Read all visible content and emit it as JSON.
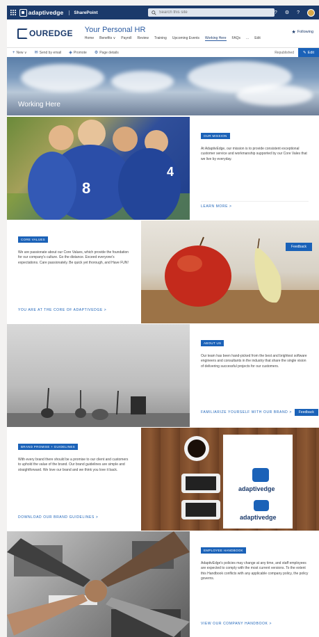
{
  "suite": {
    "brand": "adaptivedge",
    "app": "SharePoint",
    "search_placeholder": "Search this site",
    "icons": [
      "app-launcher-icon",
      "help-icon",
      "settings-icon",
      "question-icon"
    ]
  },
  "site": {
    "logo_text": "OUREDGE",
    "title": "Your Personal HR",
    "nav": [
      "Home",
      "Benefits ∨",
      "Payroll",
      "Review",
      "Training",
      "Upcoming Events",
      "Working Here",
      "FAQs",
      "...",
      "Edit"
    ],
    "active_nav": "Working Here",
    "follow_label": "Following"
  },
  "commandbar": {
    "new": "New ∨",
    "send": "Send by email",
    "promote": "Promote",
    "page_details": "Page details",
    "published": "Republished",
    "edit": "Edit"
  },
  "hero": {
    "title": "Working Here"
  },
  "sections": [
    {
      "label": "OUR MISSION",
      "body": "At AdaptivEdge, our mission is to provide consistent exceptional customer service and workmanship supported by our Core Vales that we live by everyday.",
      "link": "LEARN MORE >"
    },
    {
      "label": "CORE VALUES",
      "body": "We are passionate about our Core Values, which provide the foundation for our company's culture. Go the distance. Exceed everyone's expectations. Care passionately. Be quick yet thorough, and Have FUN!",
      "link": "YOU ARE AT THE CORE OF ADAPTIVEDGE >",
      "feedback": "Feedback"
    },
    {
      "label": "ABOUT US",
      "body": "Our team has been hand-picked from the best and brightest software engineers and consultants in the industry that share the single vision of delivering successful projects for our customers.",
      "link": "FAMILIARIZE YOURSELF WITH OUR BRAND >",
      "feedback": "Feedback"
    },
    {
      "label": "BRAND PROMISE + GUIDELINES",
      "body": "With every brand there should be a promise to our client and customers to uphold the value of the brand. Our brand guidelines are simple and straightforward. We love our brand and we think you love it back.",
      "link": "DOWNLOAD OUR BRAND GUIDELINES >",
      "brand_cards": [
        "adaptivedge",
        "adaptivedge"
      ]
    },
    {
      "label": "EMPLOYEE HANDBOOK",
      "body": "AdaptivEdge's policies may change at any time, and staff employees are expected to comply with the most current versions. To the extent this Handbook conflicts with any applicable company policy, the policy governs.",
      "link": "VIEW OUR COMPANY HANDBOOK >"
    }
  ]
}
